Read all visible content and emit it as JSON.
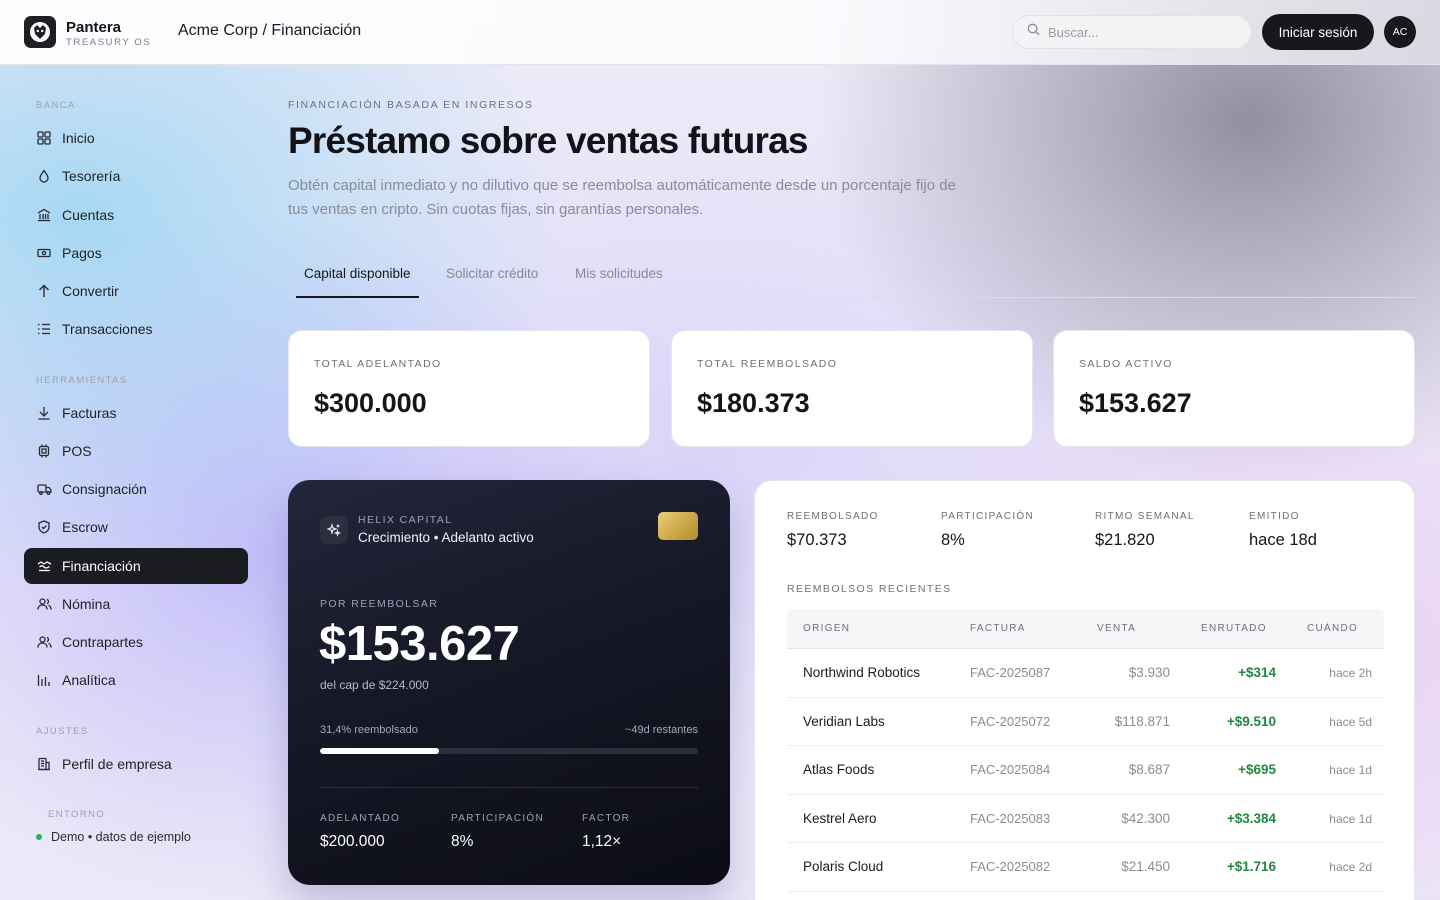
{
  "header": {
    "brand_name": "Pantera",
    "brand_sub": "TREASURY OS",
    "breadcrumb": "Acme Corp / Financiación",
    "search_placeholder": "Buscar...",
    "login_label": "Iniciar sesión",
    "avatar_initials": "AC"
  },
  "sidebar": {
    "sections": [
      {
        "label": "BANCA"
      },
      {
        "label": "HERRAMIENTAS"
      },
      {
        "label": "AJUSTES"
      }
    ],
    "items": [
      {
        "label": "Inicio",
        "icon": "grid-icon"
      },
      {
        "label": "Tesorería",
        "icon": "drop-icon"
      },
      {
        "label": "Cuentas",
        "icon": "bank-icon"
      },
      {
        "label": "Pagos",
        "icon": "cash-icon"
      },
      {
        "label": "Convertir",
        "icon": "arrow-up-icon"
      },
      {
        "label": "Transacciones",
        "icon": "list-icon"
      },
      {
        "label": "Facturas",
        "icon": "download-icon"
      },
      {
        "label": "POS",
        "icon": "chip-icon"
      },
      {
        "label": "Consignación",
        "icon": "truck-icon"
      },
      {
        "label": "Escrow",
        "icon": "shield-icon"
      },
      {
        "label": "Financiación",
        "icon": "handshake-icon",
        "active": true
      },
      {
        "label": "Nómina",
        "icon": "users-icon"
      },
      {
        "label": "Contrapartes",
        "icon": "users-icon"
      },
      {
        "label": "Analítica",
        "icon": "bars-icon"
      },
      {
        "label": "Perfil de empresa",
        "icon": "building-icon"
      }
    ],
    "env_label": "ENTORNO",
    "env_value": "Demo • datos de ejemplo"
  },
  "main": {
    "eyebrow": "FINANCIACIÓN BASADA EN INGRESOS",
    "title": "Préstamo sobre ventas futuras",
    "description": "Obtén capital inmediato y no dilutivo que se reembolsa automáticamente desde un porcentaje fijo de tus ventas en cripto. Sin cuotas fijas, sin garantías personales.",
    "tabs": [
      {
        "label": "Capital disponible",
        "active": true
      },
      {
        "label": "Solicitar crédito"
      },
      {
        "label": "Mis solicitudes"
      }
    ],
    "stats": [
      {
        "label": "TOTAL ADELANTADO",
        "value": "$300.000"
      },
      {
        "label": "TOTAL REEMBOLSADO",
        "value": "$180.373"
      },
      {
        "label": "SALDO ACTIVO",
        "value": "$153.627"
      }
    ]
  },
  "advance_card": {
    "issuer": "HELIX CAPITAL",
    "status": "Crecimiento • Adelanto activo",
    "owed_label": "POR REEMBOLSAR",
    "owed_amount": "$153.627",
    "cap_text": "del cap de $224.000",
    "progress_text": "31,4% reembolsado",
    "remaining_text": "~49d restantes",
    "progress_fraction": 0.314,
    "stats": [
      {
        "label": "ADELANTADO",
        "value": "$200.000"
      },
      {
        "label": "PARTICIPACIÓN",
        "value": "8%"
      },
      {
        "label": "FACTOR",
        "value": "1,12×"
      }
    ]
  },
  "panel": {
    "metrics": [
      {
        "label": "REEMBOLSADO",
        "value": "$70.373"
      },
      {
        "label": "PARTICIPACIÓN",
        "value": "8%"
      },
      {
        "label": "RITMO SEMANAL",
        "value": "$21.820"
      },
      {
        "label": "EMITIDO",
        "value": "hace 18d"
      }
    ],
    "recent_label": "REEMBOLSOS RECIENTES",
    "columns": [
      "ORIGEN",
      "FACTURA",
      "VENTA",
      "ENRUTADO",
      "CUÁNDO"
    ],
    "rows": [
      {
        "origin": "Northwind Robotics",
        "invoice": "FAC-2025087",
        "sale": "$3.930",
        "routed": "+$314",
        "when": "hace 2h"
      },
      {
        "origin": "Veridian Labs",
        "invoice": "FAC-2025072",
        "sale": "$118.871",
        "routed": "+$9.510",
        "when": "hace 5d"
      },
      {
        "origin": "Atlas Foods",
        "invoice": "FAC-2025084",
        "sale": "$8.687",
        "routed": "+$695",
        "when": "hace 1d"
      },
      {
        "origin": "Kestrel Aero",
        "invoice": "FAC-2025083",
        "sale": "$42.300",
        "routed": "+$3.384",
        "when": "hace 1d"
      },
      {
        "origin": "Polaris Cloud",
        "invoice": "FAC-2025082",
        "sale": "$21.450",
        "routed": "+$1.716",
        "when": "hace 2d"
      }
    ]
  },
  "colors": {
    "accent_dark": "#17181c",
    "positive": "#1f8a3e",
    "env_dot": "#22b45a"
  }
}
